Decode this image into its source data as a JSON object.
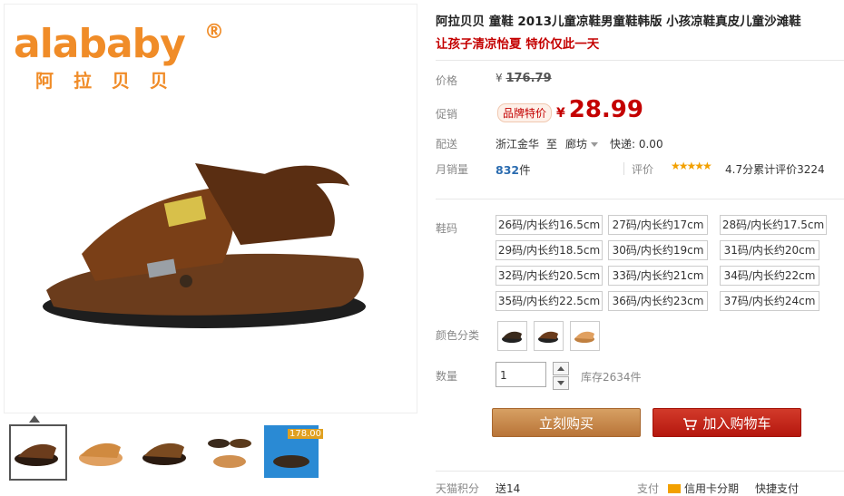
{
  "brand": {
    "logo_text": "alababy",
    "logo_cn": "阿拉贝贝",
    "reg_mark": "®"
  },
  "product": {
    "title": "阿拉贝贝 童鞋 2013儿童凉鞋男童鞋韩版 小孩凉鞋真皮儿童沙滩鞋",
    "subtitle": "让孩子清凉怡夏 特价仅此一天"
  },
  "price": {
    "label": "价格",
    "currency": "¥",
    "original": "176.79",
    "promo_label": "促销",
    "promo_badge": "品牌特价",
    "promo_currency": "¥",
    "promo_value": "28.99"
  },
  "shipping": {
    "label": "配送",
    "from": "浙江金华",
    "to_word": "至",
    "to": "廊坊",
    "fee": "快递: 0.00"
  },
  "sales": {
    "label": "月销量",
    "count": "832",
    "unit": "件",
    "rating_label": "评价",
    "stars": "★★★★★",
    "score_text": "4.7分累计评价3224"
  },
  "sizes": {
    "label": "鞋码",
    "options": [
      "26码/内长约16.5cm",
      "27码/内长约17cm",
      "28码/内长约17.5cm",
      "29码/内长约18.5cm",
      "30码/内长约19cm",
      "31码/内长约20cm",
      "32码/内长约20.5cm",
      "33码/内长约21cm",
      "34码/内长约22cm",
      "35码/内长约22.5cm",
      "36码/内长约23cm",
      "37码/内长约24cm"
    ]
  },
  "colors": {
    "label": "颜色分类",
    "options": [
      "black-sandal",
      "brown-sandal",
      "tan-sandal"
    ]
  },
  "quantity": {
    "label": "数量",
    "value": "1",
    "stock": "库存2634件"
  },
  "actions": {
    "buy_now": "立刻购买",
    "add_to_cart": "加入购物车"
  },
  "thumb_banner": "178.00",
  "bottom_strip": {
    "points_label": "天猫积分",
    "points_value": "送14",
    "pay_label": "支付",
    "pay_option": "信用卡分期",
    "pay_other": "快捷支付"
  },
  "colors_hex": {
    "accent_red": "#c40000",
    "brand_orange": "#f08c28",
    "buy_brown": "#c4854a",
    "cart_red": "#c8271b"
  }
}
